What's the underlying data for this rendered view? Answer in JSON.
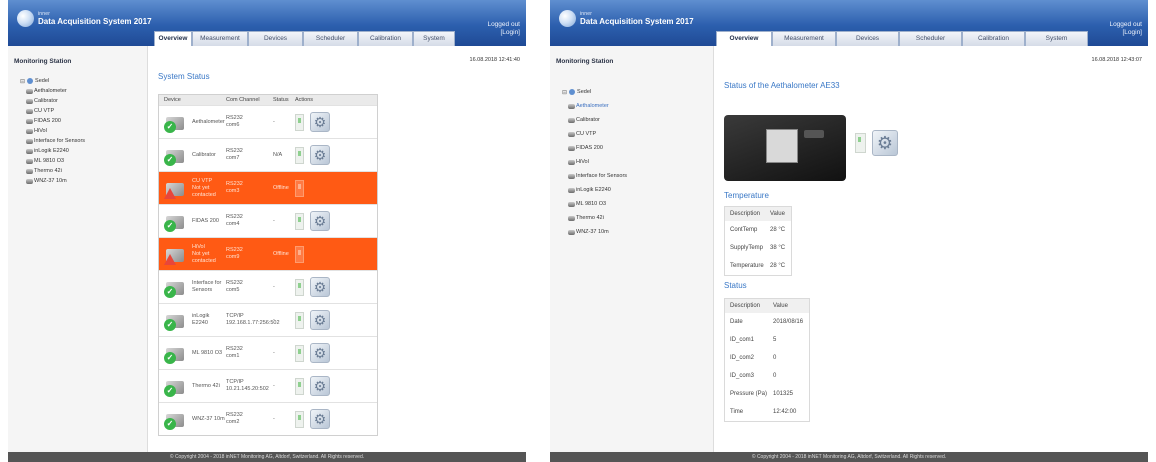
{
  "app": {
    "brand_small": "inner",
    "brand": "Data Acquisition System 2017",
    "login_line1": "Logged out",
    "login_line2": "[Login]"
  },
  "tabs": [
    "Overview",
    "Measurement",
    "Devices",
    "Scheduler",
    "Calibration",
    "System"
  ],
  "sidebar": {
    "title": "Monitoring Station",
    "root": "Sedel",
    "items": [
      "Aethalometer",
      "Calibrator",
      "CU VTP",
      "FIDAS 200",
      "HiVol",
      "Interface for Sensors",
      "inLogik E2240",
      "ML 9810 O3",
      "Thermo 42i",
      "WNZ-37 10m"
    ]
  },
  "left": {
    "timestamp": "16.08.2018 12:41:40",
    "section_title": "System Status",
    "columns": [
      "Device",
      "Com Channel",
      "Status",
      "Actions"
    ],
    "rows": [
      {
        "device": "Aethalometer",
        "sub": "",
        "com1": "RS232",
        "com2": "com6",
        "status": "-",
        "offline": false
      },
      {
        "device": "Calibrator",
        "sub": "",
        "com1": "RS232",
        "com2": "com7",
        "status": "N/A",
        "offline": false
      },
      {
        "device": "CU VTP",
        "sub": "Not yet contacted",
        "com1": "RS232",
        "com2": "com3",
        "status": "Offline",
        "offline": true
      },
      {
        "device": "FIDAS 200",
        "sub": "",
        "com1": "RS232",
        "com2": "com4",
        "status": "-",
        "offline": false
      },
      {
        "device": "HiVol",
        "sub": "Not yet contacted",
        "com1": "RS232",
        "com2": "com9",
        "status": "Offline",
        "offline": true
      },
      {
        "device": "Interface for Sensors",
        "sub": "",
        "com1": "RS232",
        "com2": "com5",
        "status": "-",
        "offline": false
      },
      {
        "device": "inLogik E2240",
        "sub": "",
        "com1": "TCP/IP",
        "com2": "192.168.1.77:256:502",
        "status": "-",
        "offline": false
      },
      {
        "device": "ML 9810 O3",
        "sub": "",
        "com1": "RS232",
        "com2": "com1",
        "status": "-",
        "offline": false
      },
      {
        "device": "Thermo 42i",
        "sub": "",
        "com1": "TCP/IP",
        "com2": "10.21.145.20:502",
        "status": "-",
        "offline": false
      },
      {
        "device": "WNZ-37 10m",
        "sub": "",
        "com1": "RS232",
        "com2": "com2",
        "status": "-",
        "offline": false
      }
    ],
    "footer": "© Copyright 2004 - 2018 inNET Monitoring AG, Altdorf, Switzerland. All Rights reserved."
  },
  "right": {
    "timestamp": "16.08.2018 12:43:07",
    "device_title": "Status of the Aethalometer AE33",
    "temperature_title": "Temperature",
    "temperature_cols": [
      "Description",
      "Value"
    ],
    "temperature_rows": [
      {
        "desc": "ContTemp",
        "value": "28 °C"
      },
      {
        "desc": "SupplyTemp",
        "value": "38 °C"
      },
      {
        "desc": "Temperature",
        "value": "28 °C"
      }
    ],
    "status_title": "Status",
    "status_cols": [
      "Description",
      "Value"
    ],
    "status_rows": [
      {
        "desc": "Date",
        "value": "2018/08/16"
      },
      {
        "desc": "ID_com1",
        "value": "5"
      },
      {
        "desc": "ID_com2",
        "value": "0"
      },
      {
        "desc": "ID_com3",
        "value": "0"
      },
      {
        "desc": "Pressure (Pa)",
        "value": "101325"
      },
      {
        "desc": "Time",
        "value": "12:42:00"
      }
    ],
    "footer": "© Copyright 2004 - 2018 inNET Monitoring AG, Altdorf, Switzerland. All Rights reserved."
  }
}
